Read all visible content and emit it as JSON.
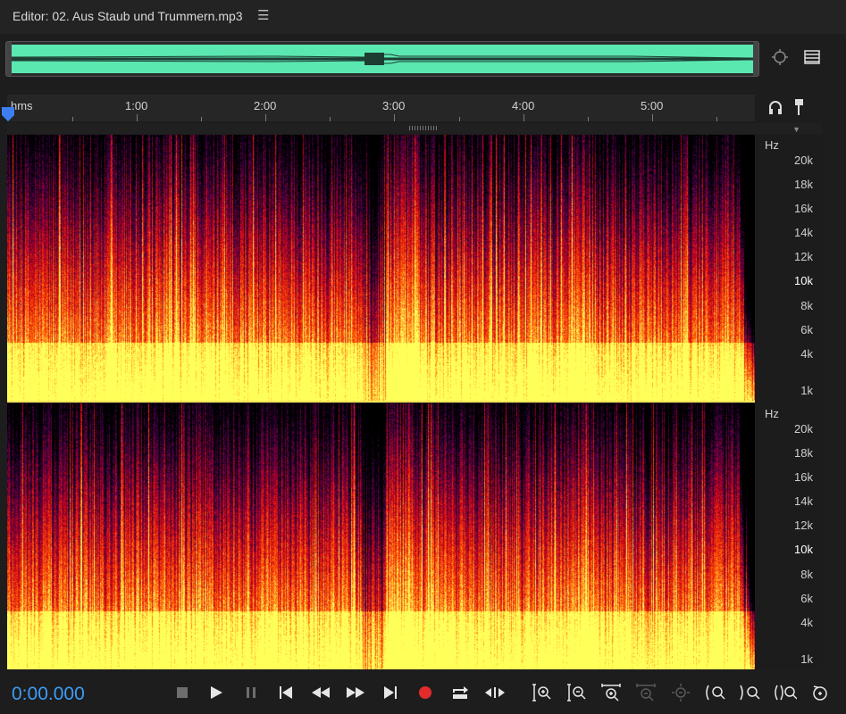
{
  "editor": {
    "title": "Editor: 02. Aus Staub und Trummern.mp3",
    "menu_icon": "hamburger-icon"
  },
  "overview": {
    "waveform_color": "#5be8b0",
    "icons": [
      "zoom-target-icon",
      "list-icon"
    ]
  },
  "timeline": {
    "labels": [
      "hms",
      "1:00",
      "2:00",
      "3:00",
      "4:00",
      "5:00"
    ],
    "side_icons": [
      "headphones-icon",
      "marker-pin-icon"
    ],
    "accent": "#3d7ff0"
  },
  "spectral": {
    "unit": "Hz",
    "freq_labels": [
      "20k",
      "18k",
      "16k",
      "14k",
      "12k",
      "10k",
      "8k",
      "6k",
      "4k",
      "1k"
    ],
    "channels": [
      "left",
      "right"
    ]
  },
  "transport": {
    "time": "0:00.000",
    "time_color": "#3d9df5",
    "record_color": "#e32b2b",
    "buttons": [
      "stop-icon",
      "play-icon",
      "pause-icon",
      "go-to-start-icon",
      "rewind-icon",
      "fast-forward-icon",
      "go-to-end-icon",
      "record-icon",
      "loop-icon",
      "skip-selection-icon",
      "zoom-in-amplitude-icon",
      "zoom-out-amplitude-icon",
      "zoom-in-time-icon",
      "zoom-out-full-icon",
      "zoom-out-time-icon",
      "zoom-to-in-point-icon",
      "zoom-to-out-point-icon",
      "zoom-to-selection-icon",
      "zoom-reset-icon"
    ]
  }
}
